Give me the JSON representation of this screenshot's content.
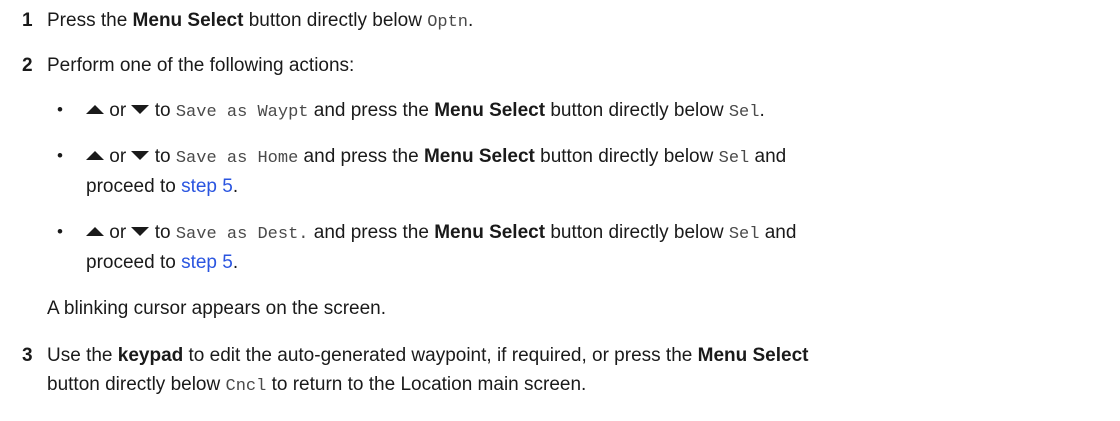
{
  "steps": [
    {
      "number": "1",
      "text_a": "Press the ",
      "bold_a": "Menu Select",
      "text_b": " button directly below ",
      "mono_a": "Optn",
      "text_c": "."
    },
    {
      "number": "2",
      "intro": "Perform one of the following actions:",
      "bullets": [
        {
          "bullet": "•",
          "or": " or ",
          "to": " to ",
          "mono_target": "Save as Waypt",
          "text_a": " and press the ",
          "bold": "Menu Select",
          "text_b": " button directly below ",
          "mono_sel": "Sel",
          "text_c": "."
        },
        {
          "bullet": "•",
          "or": " or ",
          "to": " to ",
          "mono_target": "Save as Home",
          "text_a": " and press the ",
          "bold": "Menu Select",
          "text_b": " button directly below ",
          "mono_sel": "Sel",
          "text_c": " and",
          "line2_a": "proceed to ",
          "link": "step 5",
          "line2_b": "."
        },
        {
          "bullet": "•",
          "or": " or ",
          "to": " to ",
          "mono_target": "Save as Dest.",
          "text_a": " and press the ",
          "bold": "Menu Select",
          "text_b": " button directly below ",
          "mono_sel": "Sel",
          "text_c": " and",
          "line2_a": "proceed to ",
          "link": "step 5",
          "line2_b": "."
        }
      ],
      "note": "A blinking cursor appears on the screen."
    },
    {
      "number": "3",
      "text_a": "Use the ",
      "bold_a": "keypad",
      "text_b": " to edit the auto-generated waypoint, if required, or press the ",
      "bold_b": "Menu Select",
      "line2_a": "button directly below ",
      "mono_a": "Cncl",
      "line2_b": " to return to the Location main screen."
    }
  ],
  "icons": {
    "up": "up-arrow-icon",
    "down": "down-arrow-icon"
  }
}
